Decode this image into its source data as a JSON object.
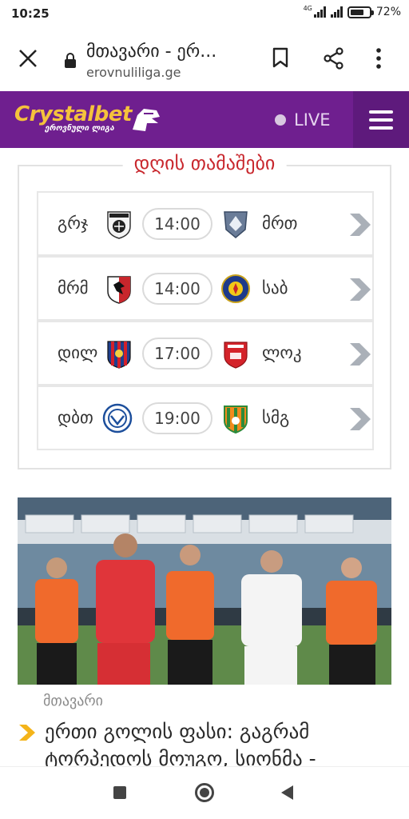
{
  "status": {
    "time": "10:25",
    "network": "4G",
    "battery": "72%",
    "battery_level": 0.72
  },
  "browser": {
    "page_title": "მთავარი - ერ...",
    "url": "erovnuliliga.ge",
    "icons": [
      "close-icon",
      "lock-icon",
      "bookmark-icon",
      "share-icon",
      "more-icon"
    ]
  },
  "site": {
    "brand": "Crystalbet",
    "brand_sub": "ეროვნული ლიგა",
    "live_label": "LIVE",
    "colors": {
      "header": "#6f1f8f",
      "brand": "#f5c23c",
      "accent_red": "#c8262c",
      "arrow": "#aab0b8"
    }
  },
  "matches": {
    "title": "დღის თამაშები",
    "items": [
      {
        "home": "გრჯ",
        "time": "14:00",
        "away": "მრთ"
      },
      {
        "home": "მრმ",
        "time": "14:00",
        "away": "საბ"
      },
      {
        "home": "დილ",
        "time": "17:00",
        "away": "ლოკ"
      },
      {
        "home": "დბთ",
        "time": "19:00",
        "away": "სმგ"
      }
    ]
  },
  "article": {
    "category": "მთავარი",
    "headline": "ერთი გოლის ფასი: გაგრამ ტორპედოს მოუგო, სიონმა -"
  }
}
